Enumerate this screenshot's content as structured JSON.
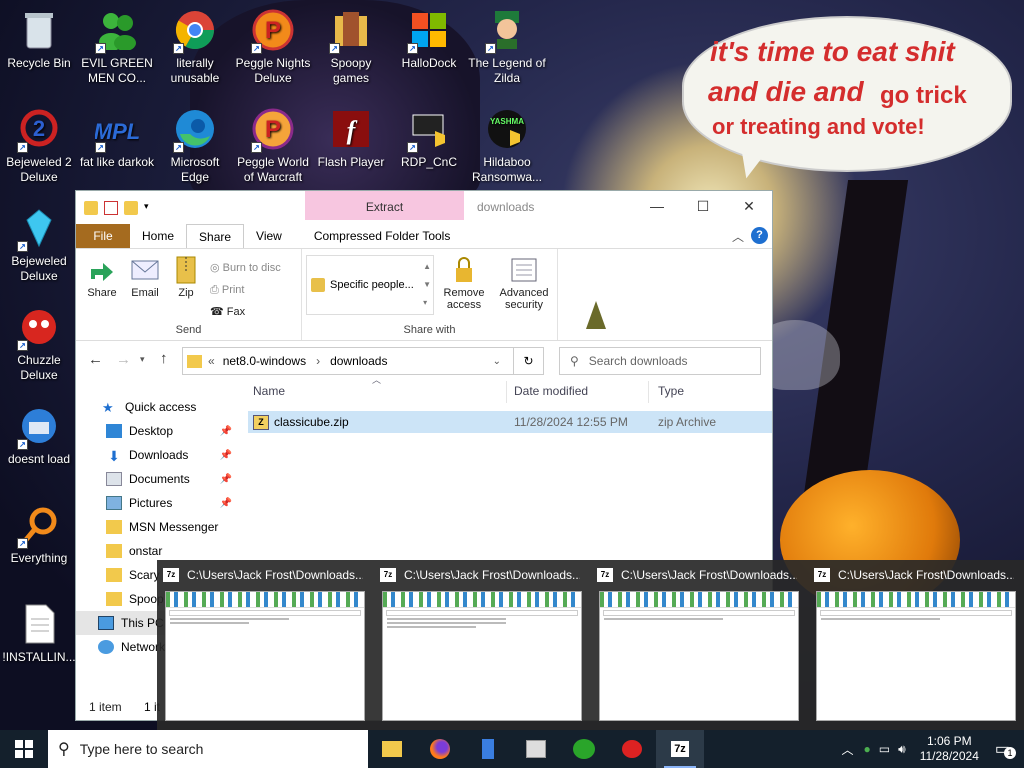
{
  "wallpaper": {
    "bubble": {
      "line1": "it's time to eat shit",
      "line2": "and die and",
      "line2b": "go trick",
      "line3": "or treating and vote!"
    }
  },
  "desktop_icons": [
    {
      "label": "Recycle Bin",
      "icon": "recycle-bin-icon"
    },
    {
      "label": "EVIL GREEN MEN CO...",
      "icon": "green-men-icon"
    },
    {
      "label": "literally unusable",
      "icon": "chrome-icon"
    },
    {
      "label": "Peggle Nights Deluxe",
      "icon": "peggle-icon"
    },
    {
      "label": "Spoopy games",
      "icon": "folder-icon"
    },
    {
      "label": "HalloDock",
      "icon": "windows-logo-icon"
    },
    {
      "label": "The Legend of Zilda",
      "icon": "zilda-icon"
    },
    {
      "label": "Bejeweled 2 Deluxe",
      "icon": "bejeweled2-icon"
    },
    {
      "label": "fat like darkok",
      "icon": "mpl-icon"
    },
    {
      "label": "Microsoft Edge",
      "icon": "edge-icon"
    },
    {
      "label": "Peggle World of Warcraft",
      "icon": "peggle-wow-icon"
    },
    {
      "label": "Flash Player",
      "icon": "flash-icon"
    },
    {
      "label": "RDP_CnC",
      "icon": "rdp-icon"
    },
    {
      "label": "Hildaboo Ransomwa...",
      "icon": "yashma-icon"
    },
    {
      "label": "Bejeweled Deluxe",
      "icon": "gem-icon"
    },
    {
      "label": "Chuzzle Deluxe",
      "icon": "chuzzle-icon"
    },
    {
      "label": "doesnt load",
      "icon": "thunderbird-icon"
    },
    {
      "label": "Everything",
      "icon": "everything-icon"
    },
    {
      "label": "!INSTALLIN...",
      "icon": "text-file-icon"
    }
  ],
  "explorer": {
    "context_tab": "Extract",
    "title": "downloads",
    "tabs": [
      "File",
      "Home",
      "Share",
      "View",
      "Compressed Folder Tools"
    ],
    "active_tab": "Share",
    "ribbon": {
      "send": {
        "label": "Send",
        "share": "Share",
        "email": "Email",
        "zip": "Zip",
        "burn": "Burn to disc",
        "print": "Print",
        "fax": "Fax"
      },
      "share_with": {
        "label": "Share with",
        "item": "Specific people...",
        "remove": "Remove access",
        "advanced": "Advanced security"
      }
    },
    "address": {
      "crumbs": [
        "net8.0-windows",
        "downloads"
      ],
      "search_placeholder": "Search downloads"
    },
    "nav_pane": [
      {
        "label": "Quick access",
        "kind": "star"
      },
      {
        "label": "Desktop",
        "kind": "desktop",
        "pinned": true
      },
      {
        "label": "Downloads",
        "kind": "download",
        "pinned": true
      },
      {
        "label": "Documents",
        "kind": "docs",
        "pinned": true
      },
      {
        "label": "Pictures",
        "kind": "pics",
        "pinned": true
      },
      {
        "label": "MSN Messenger",
        "kind": "folder"
      },
      {
        "label": "onstar",
        "kind": "folder"
      },
      {
        "label": "Scary S",
        "kind": "folder"
      },
      {
        "label": "Spoop",
        "kind": "folder"
      },
      {
        "label": "This PC",
        "kind": "pc"
      },
      {
        "label": "Network",
        "kind": "network"
      }
    ],
    "columns": [
      "Name",
      "Date modified",
      "Type"
    ],
    "files": [
      {
        "name": "classicube.zip",
        "date": "11/28/2024 12:55 PM",
        "type": "zip Archive"
      }
    ],
    "status": "1 item",
    "status_sel": "1 it"
  },
  "thumbnails": [
    {
      "title": "C:\\Users\\Jack Frost\\Downloads..."
    },
    {
      "title": "C:\\Users\\Jack Frost\\Downloads..."
    },
    {
      "title": "C:\\Users\\Jack Frost\\Downloads..."
    },
    {
      "title": "C:\\Users\\Jack Frost\\Downloads..."
    }
  ],
  "taskbar": {
    "search_placeholder": "Type here to search",
    "time": "1:06 PM",
    "date": "11/28/2024",
    "notifications": "1",
    "sevenzip": "7z"
  },
  "colors": {
    "file_tab": "#a56b1f",
    "context_tab": "#f7c6e0",
    "selected_row": "#cce4f7",
    "taskbar": "#14202c"
  }
}
